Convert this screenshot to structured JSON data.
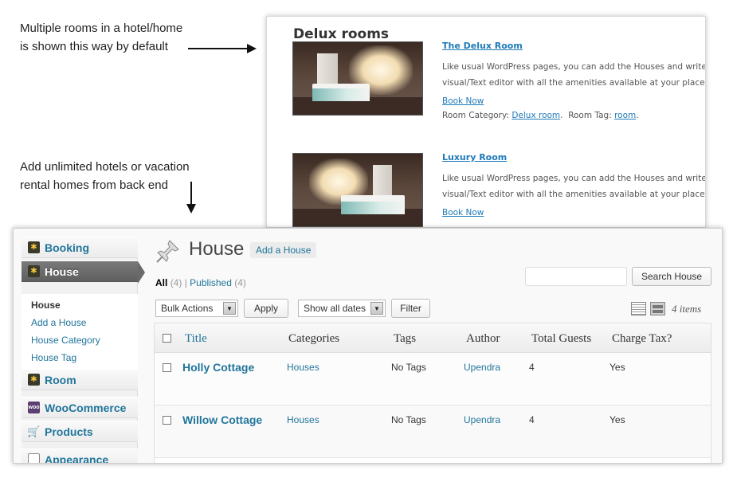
{
  "annotations": {
    "note1_line1": "Multiple rooms in a hotel/home",
    "note1_line2": "is shown this way by default",
    "note2_line1": "Add unlimited hotels or vacation",
    "note2_line2": "rental homes from back end"
  },
  "preview": {
    "heading": "Delux rooms",
    "rooms": [
      {
        "title": "The Delux Room",
        "desc_line1": "Like usual WordPress pages, you can add the Houses and write the",
        "desc_line2": "visual/Text editor with all the amenities available at your place.",
        "book_label": "Book Now",
        "category_label": "Room Category:",
        "category": "Delux room",
        "tag_label": "Room Tag:",
        "tag": "room"
      },
      {
        "title": "Luxury Room",
        "desc_line1": "Like usual WordPress pages, you can add the Houses and write the",
        "desc_line2": "visual/Text editor with all the amenities available at your place.",
        "book_label": "Book Now"
      }
    ]
  },
  "sidebar": {
    "items": [
      {
        "label": "Booking",
        "icon": "booking-icon"
      },
      {
        "label": "House",
        "icon": "house-icon",
        "active": true
      },
      {
        "label": "Room",
        "icon": "room-icon"
      },
      {
        "label": "WooCommerce",
        "icon": "woocommerce-icon",
        "icon_text": "woo"
      },
      {
        "label": "Products",
        "icon": "cart-icon"
      },
      {
        "label": "Appearance",
        "icon": "appearance-icon"
      }
    ],
    "submenu": [
      "House",
      "Add a House",
      "House Category",
      "House Tag"
    ]
  },
  "main": {
    "title": "House",
    "add_new": "Add a House",
    "views": {
      "all_label": "All",
      "all_count": "(4)",
      "separator": "|",
      "published_label": "Published",
      "published_count": "(4)"
    },
    "search_placeholder": "",
    "search_button": "Search House",
    "bulk_actions": "Bulk Actions",
    "apply": "Apply",
    "date_filter": "Show all dates",
    "filter": "Filter",
    "items_count": "4 items",
    "columns": [
      "Title",
      "Categories",
      "Tags",
      "Author",
      "Total Guests",
      "Charge Tax?"
    ],
    "rows": [
      {
        "title": "Holly Cottage",
        "categories": "Houses",
        "tags": "No Tags",
        "author": "Upendra",
        "guests": "4",
        "tax": "Yes"
      },
      {
        "title": "Willow Cottage",
        "categories": "Houses",
        "tags": "No Tags",
        "author": "Upendra",
        "guests": "4",
        "tax": "Yes"
      }
    ]
  },
  "colors": {
    "link": "#21759b",
    "frontend_link": "#1e7ab8",
    "active_menu": "#6a6a6a"
  }
}
